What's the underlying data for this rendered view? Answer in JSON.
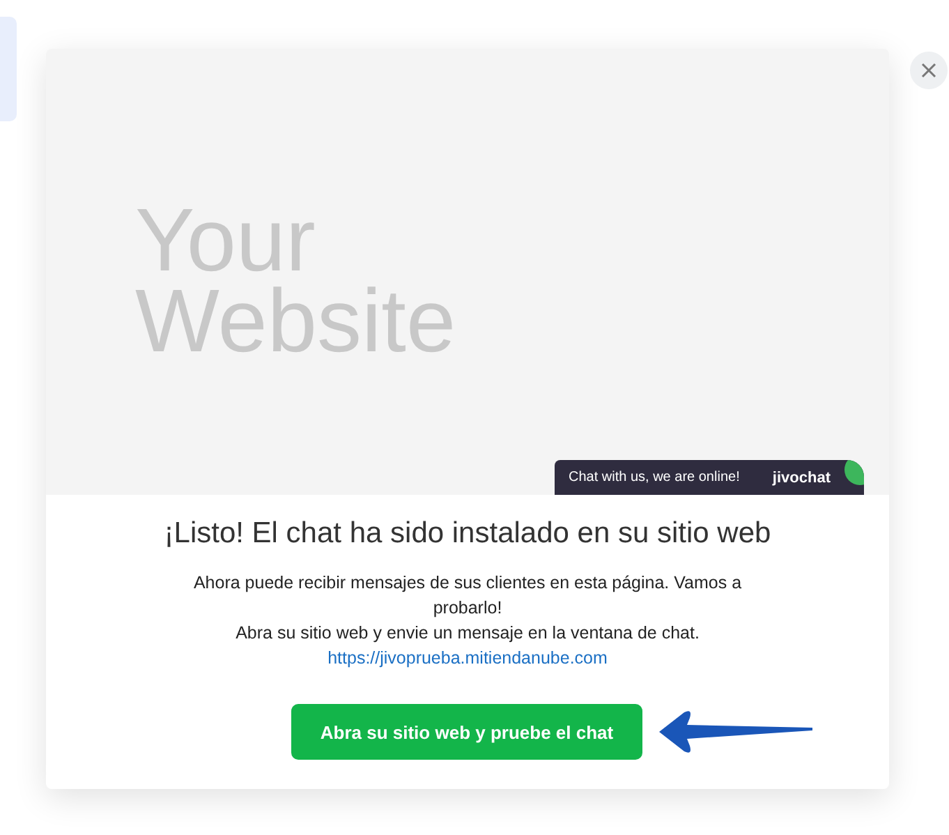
{
  "preview": {
    "placeholder_title": [
      "Your",
      "Website"
    ],
    "chat_bar": {
      "label": "Chat with us, we are online!",
      "brand": "jivochat"
    }
  },
  "dialog": {
    "title": "¡Listo! El chat ha sido instalado en su sitio web",
    "message": [
      "Ahora puede recibir mensajes de sus clientes en esta página. Vamos a probarlo!",
      "Abra su sitio web y envie un mensaje en la ventana de chat."
    ],
    "link": "https://jivoprueba.mitiendanube.com",
    "button": "Abra su sitio web y pruebe el chat"
  }
}
